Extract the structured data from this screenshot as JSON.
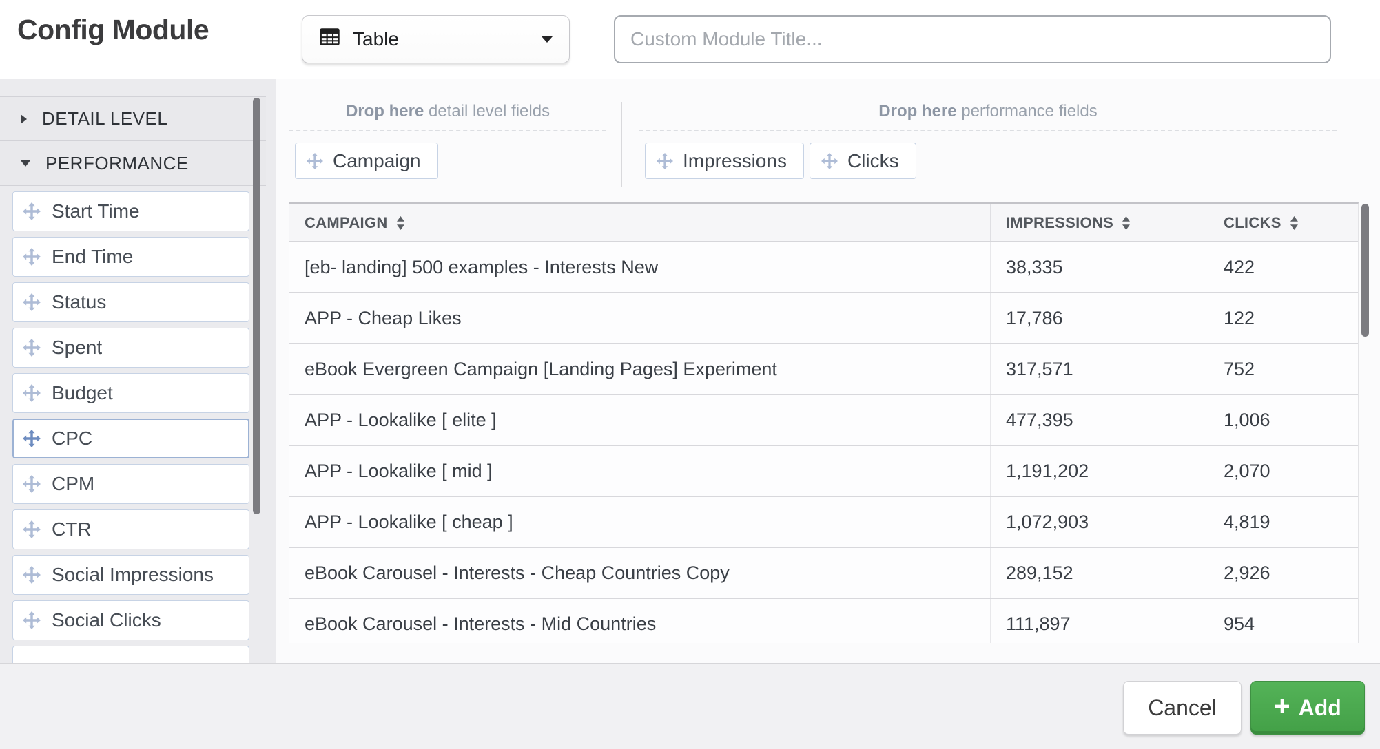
{
  "header": {
    "title": "Config Module",
    "type_select": {
      "value": "Table"
    },
    "title_input": {
      "value": "",
      "placeholder": "Custom Module Title..."
    }
  },
  "sidebar": {
    "sections": [
      {
        "label": "DETAIL LEVEL",
        "state": "collapsed"
      },
      {
        "label": "PERFORMANCE",
        "state": "expanded"
      }
    ],
    "fields": [
      "Start Time",
      "End Time",
      "Status",
      "Spent",
      "Budget",
      "CPC",
      "CPM",
      "CTR",
      "Social Impressions",
      "Social Clicks"
    ],
    "highlighted_field": "CPC"
  },
  "dropzones": {
    "detail": {
      "label_bold": "Drop here",
      "label_rest": " detail level fields",
      "chips": [
        "Campaign"
      ]
    },
    "performance": {
      "label_bold": "Drop here",
      "label_rest": " performance fields",
      "chips": [
        "Impressions",
        "Clicks"
      ]
    }
  },
  "table": {
    "columns": [
      "CAMPAIGN",
      "IMPRESSIONS",
      "CLICKS"
    ],
    "rows": [
      [
        "[eb- landing] 500 examples - Interests New",
        "38,335",
        "422"
      ],
      [
        "APP - Cheap Likes",
        "17,786",
        "122"
      ],
      [
        "eBook Evergreen Campaign [Landing Pages] Experiment",
        "317,571",
        "752"
      ],
      [
        "APP - Lookalike [ elite ]",
        "477,395",
        "1,006"
      ],
      [
        "APP - Lookalike [ mid ]",
        "1,191,202",
        "2,070"
      ],
      [
        "APP - Lookalike [ cheap ]",
        "1,072,903",
        "4,819"
      ],
      [
        "eBook Carousel - Interests - Cheap Countries Copy",
        "289,152",
        "2,926"
      ],
      [
        "eBook Carousel - Interests - Mid Countries",
        "111,897",
        "954"
      ]
    ]
  },
  "footer": {
    "cancel_label": "Cancel",
    "add_label": "Add",
    "add_icon": "+"
  },
  "colors": {
    "accent_green": "#43a047",
    "highlight_blue": "#9cb2d4",
    "chip_border": "#c7d3e5",
    "move_icon": "#aebcd6",
    "move_icon_active": "#6d8cc0"
  }
}
